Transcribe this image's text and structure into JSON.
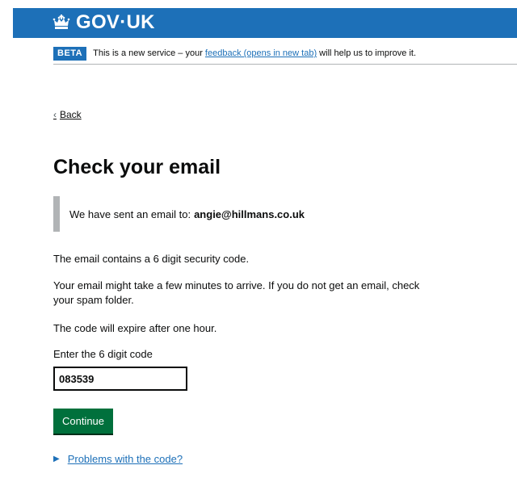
{
  "header": {
    "logo_text": "GOV·UK",
    "logo_icon": "crown-icon",
    "background": "#1d70b8"
  },
  "phase_banner": {
    "tag": "BETA",
    "text_before": "This is a new service – your ",
    "link_text": "feedback (opens in new tab)",
    "text_after": " will help us to improve it."
  },
  "back_link": {
    "icon": "chevron-left-icon",
    "label": "Back"
  },
  "page_title": "Check your email",
  "inset": {
    "text": "We have sent an email to:",
    "email": "angie@hillmans.co.uk"
  },
  "paragraphs": {
    "p1": "The email contains a 6 digit security code.",
    "p2": "Your email might take a few minutes to arrive. If you do not get an email, check your spam folder.",
    "p3": "The code will expire after one hour."
  },
  "code_field": {
    "label": "Enter the 6 digit code",
    "value": "083539"
  },
  "continue_button": {
    "label": "Continue",
    "color": "#00703c"
  },
  "details": {
    "icon": "triangle-right-icon",
    "summary": "Problems with the code?"
  }
}
